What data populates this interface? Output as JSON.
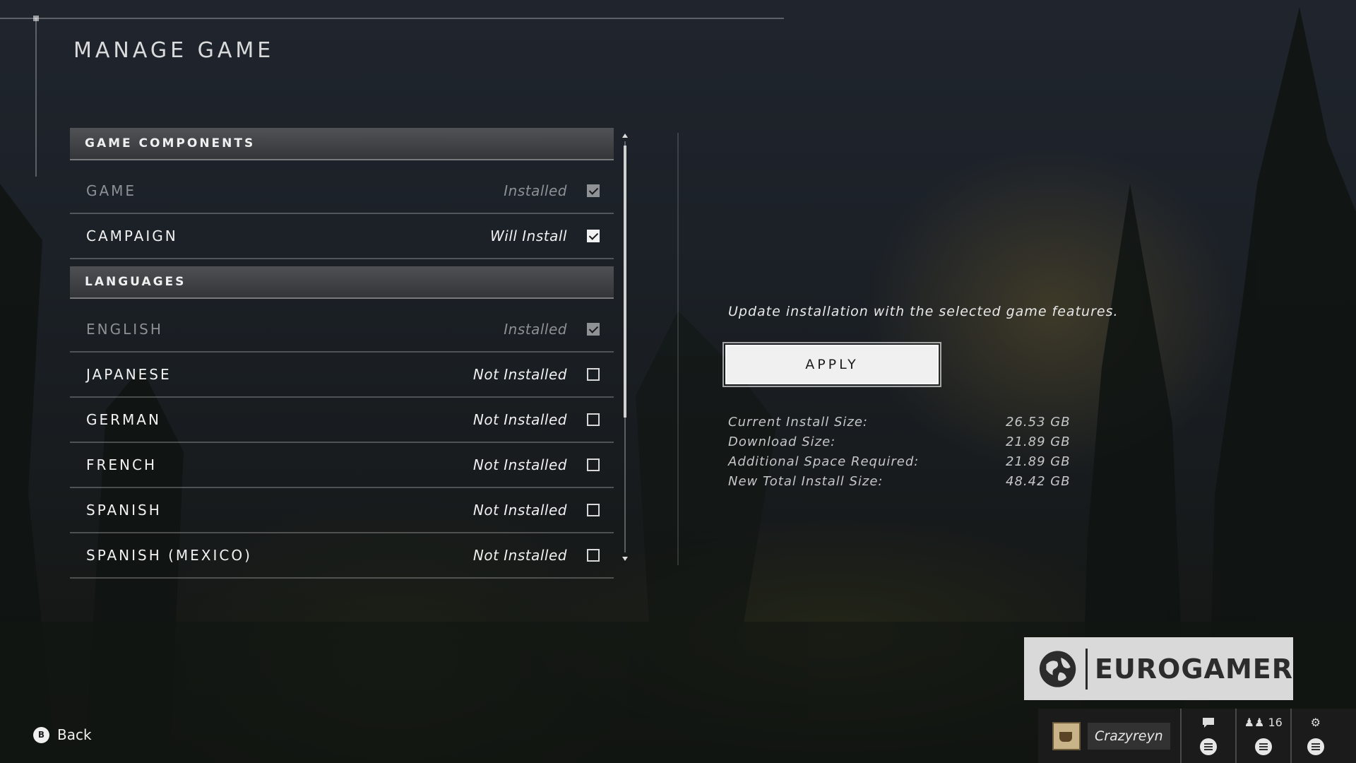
{
  "page": {
    "title": "MANAGE GAME"
  },
  "sections": [
    {
      "header": "GAME COMPONENTS",
      "items": [
        {
          "name": "GAME",
          "status": "Installed",
          "checked": true,
          "disabled": true
        },
        {
          "name": "CAMPAIGN",
          "status": "Will Install",
          "checked": true,
          "disabled": false
        }
      ]
    },
    {
      "header": "LANGUAGES",
      "items": [
        {
          "name": "ENGLISH",
          "status": "Installed",
          "checked": true,
          "disabled": true
        },
        {
          "name": "JAPANESE",
          "status": "Not Installed",
          "checked": false,
          "disabled": false
        },
        {
          "name": "GERMAN",
          "status": "Not Installed",
          "checked": false,
          "disabled": false
        },
        {
          "name": "FRENCH",
          "status": "Not Installed",
          "checked": false,
          "disabled": false
        },
        {
          "name": "SPANISH",
          "status": "Not Installed",
          "checked": false,
          "disabled": false
        },
        {
          "name": "SPANISH (MEXICO)",
          "status": "Not Installed",
          "checked": false,
          "disabled": false
        }
      ]
    }
  ],
  "details": {
    "description": "Update installation with the selected game features.",
    "apply_label": "APPLY",
    "stats": [
      {
        "label": "Current Install Size:",
        "value": "26.53 GB"
      },
      {
        "label": "Download Size:",
        "value": "21.89 GB"
      },
      {
        "label": "Additional Space Required:",
        "value": "21.89 GB"
      },
      {
        "label": "New Total Install Size:",
        "value": "48.42 GB"
      }
    ]
  },
  "footer": {
    "back_button_glyph": "B",
    "back_label": "Back",
    "logo_text": "EUROGAMER",
    "gamertag": "Crazyreyn",
    "friends_count": "16",
    "icons": [
      "chat-icon",
      "friends-icon",
      "settings-icon",
      "menu-icon",
      "party-icon",
      "globe-icon"
    ]
  }
}
